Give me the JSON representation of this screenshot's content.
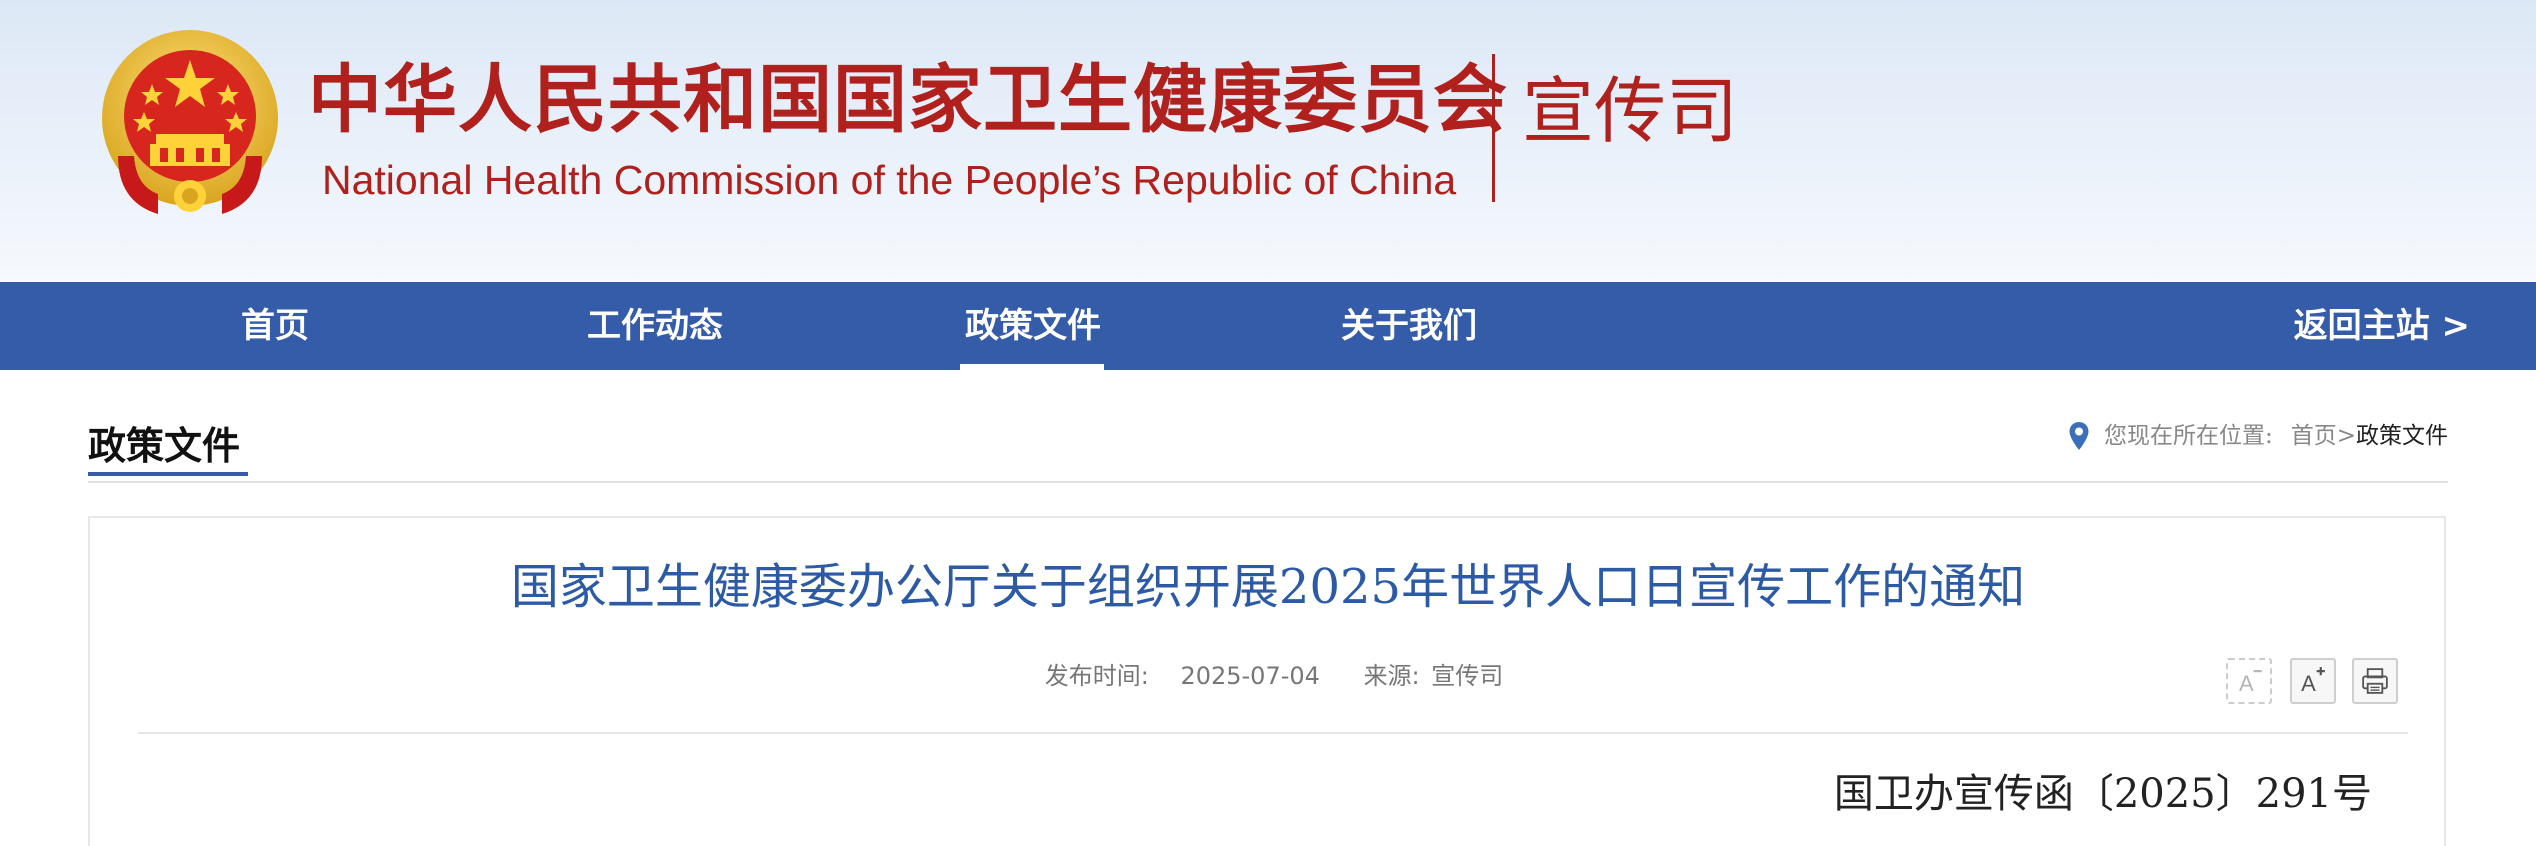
{
  "header": {
    "org_name_cn": "中华人民共和国国家卫生健康委员会",
    "org_name_en": "National Health Commission of the People’s  Republic of China",
    "department": "宣传司",
    "emblem_icon": "national-emblem-icon",
    "brand_color": "#b0201c"
  },
  "nav": {
    "items": [
      {
        "label": "首页"
      },
      {
        "label": "工作动态"
      },
      {
        "label": "政策文件"
      },
      {
        "label": "关于我们"
      }
    ],
    "active": "政策文件",
    "return_label": "返回主站 >",
    "background_color": "#355ca8"
  },
  "section": {
    "title": "政策文件"
  },
  "breadcrumb": {
    "prefix": "您现在所在位置:",
    "home": "首页",
    "separator": ">",
    "current": "政策文件",
    "icon": "location-pin-icon"
  },
  "article": {
    "title": "国家卫生健康委办公厅关于组织开展2025年世界人口日宣传工作的通知",
    "publish_label": "发布时间:",
    "publish_date": "2025-07-04",
    "source_label": "来源:",
    "source": "宣传司",
    "doc_number": "国卫办宣传函〔2025〕291号",
    "title_color": "#2d5aa5"
  },
  "tools": {
    "decrease_font": "A",
    "increase_font": "A",
    "icons": [
      "font-decrease-icon",
      "font-increase-icon",
      "print-icon"
    ]
  }
}
